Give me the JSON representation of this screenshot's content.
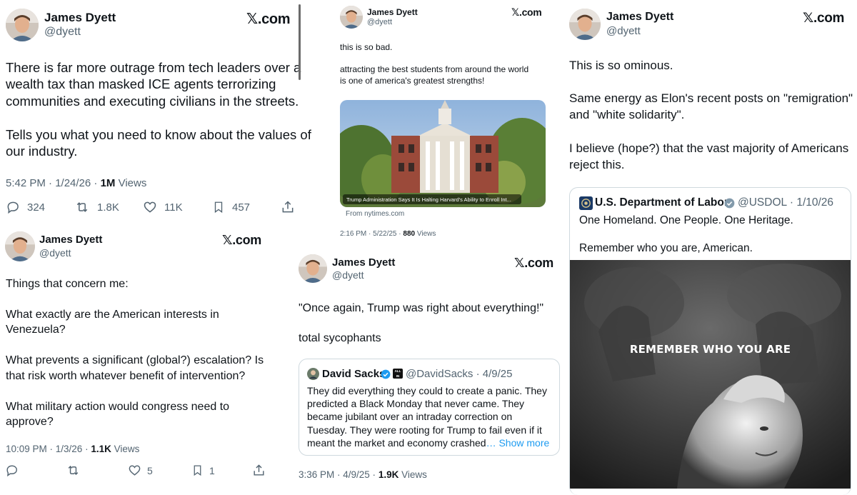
{
  "tweet1": {
    "name": "James Dyett",
    "handle": "@dyett",
    "x_logo": "𝕏.com",
    "text": "There is far more outrage from tech leaders over a\nwealth tax than masked ICE agents terrorizing\ncommunities and executing civilians in the streets.\n\nTells you what you need to know about the values of\nour industry.",
    "timestamp": "5:42 PM · 1/24/26 · ",
    "views_count": "1M",
    "views_label": " Views",
    "replies": "324",
    "reposts": "1.8K",
    "likes": "11K",
    "bookmarks": "457"
  },
  "tweet2": {
    "name": "James Dyett",
    "handle": "@dyett",
    "x_logo": "𝕏.com",
    "text": "Things that concern me:\n\nWhat exactly are the American interests in\nVenezuela?\n\nWhat prevents a significant (global?) escalation? Is\nthat risk worth whatever benefit of intervention?\n\nWhat military action would congress need to\napprove?",
    "timestamp": "10:09 PM · 1/3/26 · ",
    "views_count": "1.1K",
    "views_label": " Views",
    "likes": "5",
    "bookmarks": "1"
  },
  "tweet3": {
    "name": "James Dyett",
    "handle": "@dyett",
    "x_logo": "𝕏.com",
    "text": "this is so bad.\n\nattracting the best students from around the world\nis one of america's greatest strengths!",
    "link_caption": "Trump Administration Says It Is Halting Harvard's Ability to Enroll Int...",
    "link_source": "From nytimes.com",
    "timestamp": "2:16 PM · 5/22/25 · ",
    "views_count": "880",
    "views_label": " Views"
  },
  "tweet4": {
    "name": "James Dyett",
    "handle": "@dyett",
    "x_logo": "𝕏.com",
    "text": "\"Once again, Trump was right about everything!\"\n\ntotal sycophants",
    "timestamp": "3:36 PM · 4/9/25 · ",
    "views_count": "1.9K",
    "views_label": " Views",
    "quote": {
      "name": "David Sacks",
      "badge_text": "ALL IN",
      "handle_date": "@DavidSacks · 4/9/25",
      "text": "They did everything they could to create a panic. They\npredicted a Black Monday that never came. They\nbecame jubilant over an intraday correction on\nTuesday. They were rooting for Trump to fail even if it\nmeant the market and economy crashed",
      "show_more": "… Show more"
    }
  },
  "tweet5": {
    "name": "James Dyett",
    "handle": "@dyett",
    "x_logo": "𝕏.com",
    "text": "This is so ominous.\n\nSame energy as Elon's recent posts on \"remigration\"\nand \"white solidarity\".\n\nI believe (hope?) that the vast majority of Americans\nreject this.",
    "quote": {
      "name": "U.S. Department of Labor",
      "handle_date": "@USDOL · 1/10/26",
      "text": "One Homeland. One People. One Heritage.\n\nRemember who you are, American.",
      "image_caption": "REMEMBER WHO YOU ARE"
    }
  },
  "colors": {
    "text": "#0f1419",
    "secondary": "#536471",
    "verified": "#1d9bf0",
    "border": "#cfd9de"
  }
}
